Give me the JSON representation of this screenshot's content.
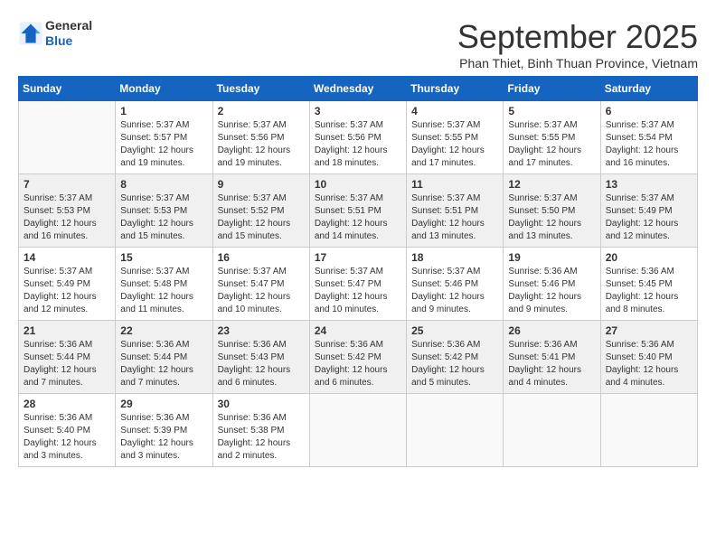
{
  "header": {
    "logo_general": "General",
    "logo_blue": "Blue",
    "month_year": "September 2025",
    "location": "Phan Thiet, Binh Thuan Province, Vietnam"
  },
  "weekdays": [
    "Sunday",
    "Monday",
    "Tuesday",
    "Wednesday",
    "Thursday",
    "Friday",
    "Saturday"
  ],
  "weeks": [
    [
      {
        "day": "",
        "info": ""
      },
      {
        "day": "1",
        "info": "Sunrise: 5:37 AM\nSunset: 5:57 PM\nDaylight: 12 hours\nand 19 minutes."
      },
      {
        "day": "2",
        "info": "Sunrise: 5:37 AM\nSunset: 5:56 PM\nDaylight: 12 hours\nand 19 minutes."
      },
      {
        "day": "3",
        "info": "Sunrise: 5:37 AM\nSunset: 5:56 PM\nDaylight: 12 hours\nand 18 minutes."
      },
      {
        "day": "4",
        "info": "Sunrise: 5:37 AM\nSunset: 5:55 PM\nDaylight: 12 hours\nand 17 minutes."
      },
      {
        "day": "5",
        "info": "Sunrise: 5:37 AM\nSunset: 5:55 PM\nDaylight: 12 hours\nand 17 minutes."
      },
      {
        "day": "6",
        "info": "Sunrise: 5:37 AM\nSunset: 5:54 PM\nDaylight: 12 hours\nand 16 minutes."
      }
    ],
    [
      {
        "day": "7",
        "info": "Sunrise: 5:37 AM\nSunset: 5:53 PM\nDaylight: 12 hours\nand 16 minutes."
      },
      {
        "day": "8",
        "info": "Sunrise: 5:37 AM\nSunset: 5:53 PM\nDaylight: 12 hours\nand 15 minutes."
      },
      {
        "day": "9",
        "info": "Sunrise: 5:37 AM\nSunset: 5:52 PM\nDaylight: 12 hours\nand 15 minutes."
      },
      {
        "day": "10",
        "info": "Sunrise: 5:37 AM\nSunset: 5:51 PM\nDaylight: 12 hours\nand 14 minutes."
      },
      {
        "day": "11",
        "info": "Sunrise: 5:37 AM\nSunset: 5:51 PM\nDaylight: 12 hours\nand 13 minutes."
      },
      {
        "day": "12",
        "info": "Sunrise: 5:37 AM\nSunset: 5:50 PM\nDaylight: 12 hours\nand 13 minutes."
      },
      {
        "day": "13",
        "info": "Sunrise: 5:37 AM\nSunset: 5:49 PM\nDaylight: 12 hours\nand 12 minutes."
      }
    ],
    [
      {
        "day": "14",
        "info": "Sunrise: 5:37 AM\nSunset: 5:49 PM\nDaylight: 12 hours\nand 12 minutes."
      },
      {
        "day": "15",
        "info": "Sunrise: 5:37 AM\nSunset: 5:48 PM\nDaylight: 12 hours\nand 11 minutes."
      },
      {
        "day": "16",
        "info": "Sunrise: 5:37 AM\nSunset: 5:47 PM\nDaylight: 12 hours\nand 10 minutes."
      },
      {
        "day": "17",
        "info": "Sunrise: 5:37 AM\nSunset: 5:47 PM\nDaylight: 12 hours\nand 10 minutes."
      },
      {
        "day": "18",
        "info": "Sunrise: 5:37 AM\nSunset: 5:46 PM\nDaylight: 12 hours\nand 9 minutes."
      },
      {
        "day": "19",
        "info": "Sunrise: 5:36 AM\nSunset: 5:46 PM\nDaylight: 12 hours\nand 9 minutes."
      },
      {
        "day": "20",
        "info": "Sunrise: 5:36 AM\nSunset: 5:45 PM\nDaylight: 12 hours\nand 8 minutes."
      }
    ],
    [
      {
        "day": "21",
        "info": "Sunrise: 5:36 AM\nSunset: 5:44 PM\nDaylight: 12 hours\nand 7 minutes."
      },
      {
        "day": "22",
        "info": "Sunrise: 5:36 AM\nSunset: 5:44 PM\nDaylight: 12 hours\nand 7 minutes."
      },
      {
        "day": "23",
        "info": "Sunrise: 5:36 AM\nSunset: 5:43 PM\nDaylight: 12 hours\nand 6 minutes."
      },
      {
        "day": "24",
        "info": "Sunrise: 5:36 AM\nSunset: 5:42 PM\nDaylight: 12 hours\nand 6 minutes."
      },
      {
        "day": "25",
        "info": "Sunrise: 5:36 AM\nSunset: 5:42 PM\nDaylight: 12 hours\nand 5 minutes."
      },
      {
        "day": "26",
        "info": "Sunrise: 5:36 AM\nSunset: 5:41 PM\nDaylight: 12 hours\nand 4 minutes."
      },
      {
        "day": "27",
        "info": "Sunrise: 5:36 AM\nSunset: 5:40 PM\nDaylight: 12 hours\nand 4 minutes."
      }
    ],
    [
      {
        "day": "28",
        "info": "Sunrise: 5:36 AM\nSunset: 5:40 PM\nDaylight: 12 hours\nand 3 minutes."
      },
      {
        "day": "29",
        "info": "Sunrise: 5:36 AM\nSunset: 5:39 PM\nDaylight: 12 hours\nand 3 minutes."
      },
      {
        "day": "30",
        "info": "Sunrise: 5:36 AM\nSunset: 5:38 PM\nDaylight: 12 hours\nand 2 minutes."
      },
      {
        "day": "",
        "info": ""
      },
      {
        "day": "",
        "info": ""
      },
      {
        "day": "",
        "info": ""
      },
      {
        "day": "",
        "info": ""
      }
    ]
  ]
}
